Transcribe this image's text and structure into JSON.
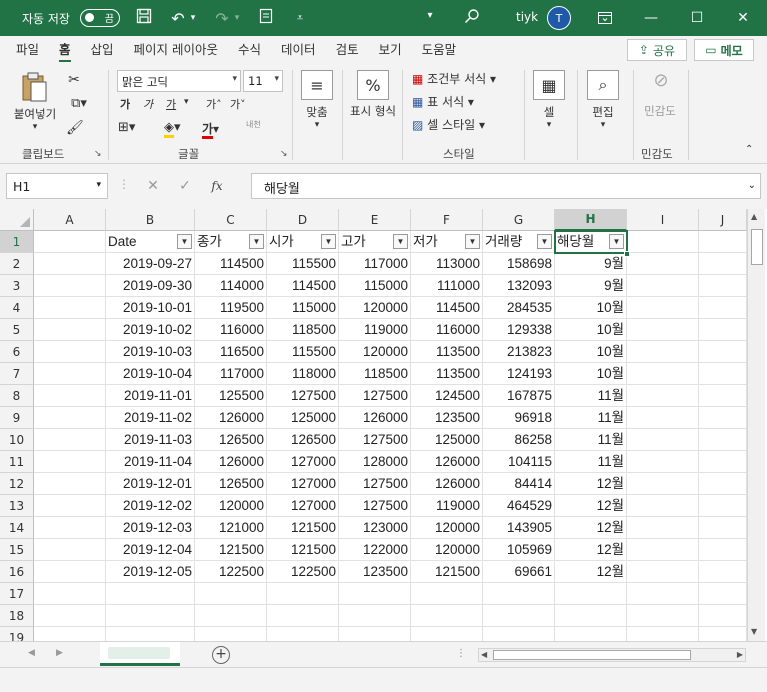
{
  "titlebar": {
    "autosave_label": "자동 저장",
    "autosave_state": "끔",
    "user_name": "tiyk",
    "user_initial": "T"
  },
  "ribbon_tabs": [
    "파일",
    "홈",
    "삽입",
    "페이지 레이아웃",
    "수식",
    "데이터",
    "검토",
    "보기",
    "도움말"
  ],
  "active_tab": "홈",
  "share_label": "공유",
  "memo_label": "메모",
  "ribbon": {
    "clipboard": {
      "paste_label": "붙여넣기",
      "group_label": "클립보드"
    },
    "font": {
      "font_name": "맑은 고딕",
      "font_size": "11",
      "group_label": "글꼴",
      "bold": "가",
      "italic": "가",
      "underline": "가",
      "grow": "가˄",
      "shrink": "가˅",
      "phonetic": "내천"
    },
    "alignment": {
      "label": "맞춤"
    },
    "number": {
      "label": "표시 형식"
    },
    "styles": {
      "conditional": "조건부 서식",
      "table": "표 서식",
      "cell_style": "셀 스타일",
      "group_label": "스타일"
    },
    "cells": {
      "label": "셀"
    },
    "editing": {
      "label": "편집"
    },
    "sensitivity": {
      "label": "민감도",
      "group_label": "민감도"
    }
  },
  "formula_bar": {
    "name_box": "H1",
    "formula": "해당월"
  },
  "columns": [
    "A",
    "B",
    "C",
    "D",
    "E",
    "F",
    "G",
    "H",
    "I",
    "J"
  ],
  "selected_column": "H",
  "row_numbers": [
    "1",
    "2",
    "3",
    "4",
    "5",
    "6",
    "7",
    "8",
    "9",
    "10",
    "11",
    "12",
    "13",
    "14",
    "15",
    "16",
    "17",
    "18",
    "19"
  ],
  "table": {
    "headers": [
      "Date",
      "종가",
      "시가",
      "고가",
      "저가",
      "거래량",
      "해당월"
    ],
    "rows": [
      [
        "2019-09-27",
        "114500",
        "115500",
        "117000",
        "113000",
        "158698",
        "9월"
      ],
      [
        "2019-09-30",
        "114000",
        "114500",
        "115000",
        "111000",
        "132093",
        "9월"
      ],
      [
        "2019-10-01",
        "119500",
        "115000",
        "120000",
        "114500",
        "284535",
        "10월"
      ],
      [
        "2019-10-02",
        "116000",
        "118500",
        "119000",
        "116000",
        "129338",
        "10월"
      ],
      [
        "2019-10-03",
        "116500",
        "115500",
        "120000",
        "113500",
        "213823",
        "10월"
      ],
      [
        "2019-10-04",
        "117000",
        "118000",
        "118500",
        "113500",
        "124193",
        "10월"
      ],
      [
        "2019-11-01",
        "125500",
        "127500",
        "127500",
        "124500",
        "167875",
        "11월"
      ],
      [
        "2019-11-02",
        "126000",
        "125000",
        "126000",
        "123500",
        "96918",
        "11월"
      ],
      [
        "2019-11-03",
        "126500",
        "126500",
        "127500",
        "125000",
        "86258",
        "11월"
      ],
      [
        "2019-11-04",
        "126000",
        "127000",
        "128000",
        "126000",
        "104115",
        "11월"
      ],
      [
        "2019-12-01",
        "126500",
        "127000",
        "127500",
        "126000",
        "84414",
        "12월"
      ],
      [
        "2019-12-02",
        "120000",
        "127000",
        "127500",
        "119000",
        "464529",
        "12월"
      ],
      [
        "2019-12-03",
        "121000",
        "121500",
        "123000",
        "120000",
        "143905",
        "12월"
      ],
      [
        "2019-12-04",
        "121500",
        "121500",
        "122000",
        "120000",
        "105969",
        "12월"
      ],
      [
        "2019-12-05",
        "122500",
        "122500",
        "123500",
        "121500",
        "69661",
        "12월"
      ]
    ]
  },
  "colors": {
    "accent": "#217346"
  }
}
